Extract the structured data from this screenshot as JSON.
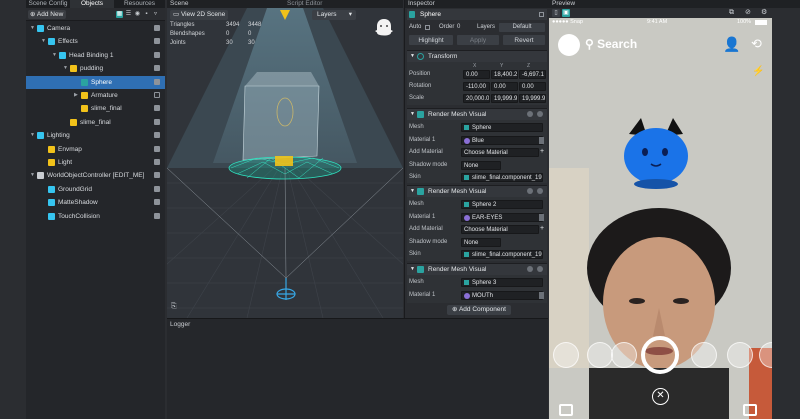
{
  "left_panel": {
    "tabs": [
      "Scene Config",
      "Objects",
      "Resources"
    ],
    "add_new_label": "Add New",
    "tree": [
      {
        "label": "Camera",
        "icon": "camera-icon",
        "indent": 0,
        "expanded": true,
        "checked": true
      },
      {
        "label": "Effects",
        "icon": "effects-icon",
        "indent": 1,
        "expanded": true,
        "checked": true
      },
      {
        "label": "Head Binding 1",
        "icon": "head-binding-icon",
        "indent": 2,
        "expanded": true,
        "checked": true
      },
      {
        "label": "pudding",
        "icon": "object-icon",
        "indent": 3,
        "expanded": true,
        "checked": true
      },
      {
        "label": "Sphere",
        "icon": "mesh-icon",
        "indent": 4,
        "expanded": false,
        "checked": true,
        "selected": true
      },
      {
        "label": "Armature",
        "icon": "armature-icon",
        "indent": 4,
        "expanded": false,
        "checked": false
      },
      {
        "label": "slime_final",
        "icon": "object-icon",
        "indent": 4,
        "expanded": false,
        "checked": true
      },
      {
        "label": "slime_final",
        "icon": "object-icon",
        "indent": 3,
        "expanded": false,
        "checked": true
      },
      {
        "label": "Lighting",
        "icon": "lighting-icon",
        "indent": 0,
        "expanded": true,
        "checked": true
      },
      {
        "label": "Envmap",
        "icon": "envmap-icon",
        "indent": 1,
        "expanded": false,
        "checked": true
      },
      {
        "label": "Light",
        "icon": "light-icon",
        "indent": 1,
        "expanded": false,
        "checked": true
      },
      {
        "label": "WorldObjectController [EDIT_ME]",
        "icon": "world-controller-icon",
        "indent": 0,
        "expanded": true,
        "checked": true
      },
      {
        "label": "GroundGrid",
        "icon": "grid-icon",
        "indent": 1,
        "expanded": false,
        "checked": true
      },
      {
        "label": "MatteShadow",
        "icon": "shadow-icon",
        "indent": 1,
        "expanded": false,
        "checked": true
      },
      {
        "label": "TouchCollision",
        "icon": "collision-icon",
        "indent": 1,
        "expanded": false,
        "checked": true
      }
    ]
  },
  "scene": {
    "tab_label": "Scene",
    "script_editor_label": "Script Editor",
    "view_button": "View 2D Scene",
    "layers_label": "Layers",
    "stats": [
      {
        "label": "Triangles",
        "v1": "3494",
        "v2": "3448"
      },
      {
        "label": "Blendshapes",
        "v1": "0",
        "v2": "0"
      },
      {
        "label": "Joints",
        "v1": "30",
        "v2": "30"
      }
    ]
  },
  "logger": {
    "label": "Logger"
  },
  "inspector": {
    "tab_label": "Inspector",
    "object_name": "Sphere",
    "auto_label": "Auto",
    "order_label": "Order",
    "order_value": "0",
    "layers_label": "Layers",
    "layers_value": "Default",
    "highlight_label": "Highlight",
    "apply_label": "Apply",
    "revert_label": "Revert",
    "transform": {
      "title": "Transform",
      "axis_labels": [
        "X",
        "Y",
        "Z"
      ],
      "rows": [
        {
          "label": "Position",
          "values": [
            "0.00",
            "18,400.2",
            "-6,697.1"
          ]
        },
        {
          "label": "Rotation",
          "values": [
            "-110.00",
            "0.00",
            "0.00"
          ]
        },
        {
          "label": "Scale",
          "values": [
            "20,000.0",
            "19,999.9",
            "19,999.9"
          ]
        }
      ]
    },
    "mesh_visuals": [
      {
        "title": "Render Mesh Visual",
        "mesh": "Sphere",
        "material": "Blue",
        "material_color": "#8a6fd6",
        "add_material": "Choose Material",
        "shadow_mode": "None",
        "skin": "slime_final.component_19"
      },
      {
        "title": "Render Mesh Visual",
        "mesh": "Sphere 2",
        "material": "EAR-EYES",
        "material_color": "#8a6fd6",
        "add_material": "Choose Material",
        "shadow_mode": "None",
        "skin": "slime_final.component_19"
      },
      {
        "title": "Render Mesh Visual",
        "mesh": "Sphere 3",
        "material": "MOUTh",
        "material_color": "#8a6fd6"
      }
    ],
    "prop_labels": {
      "mesh": "Mesh",
      "material": "Material 1",
      "add_material": "Add Material",
      "shadow_mode": "Shadow mode",
      "skin": "Skin"
    },
    "add_component_label": "Add Component"
  },
  "preview": {
    "tab_label": "Preview",
    "status_left": "●●●●● Snap",
    "status_time": "9:41 AM",
    "status_battery": "100%",
    "search_label": "Search",
    "colors": {
      "selection": "#2f6fb3",
      "accent": "#2aa3a0",
      "creature_blue": "#1a73e8"
    }
  }
}
